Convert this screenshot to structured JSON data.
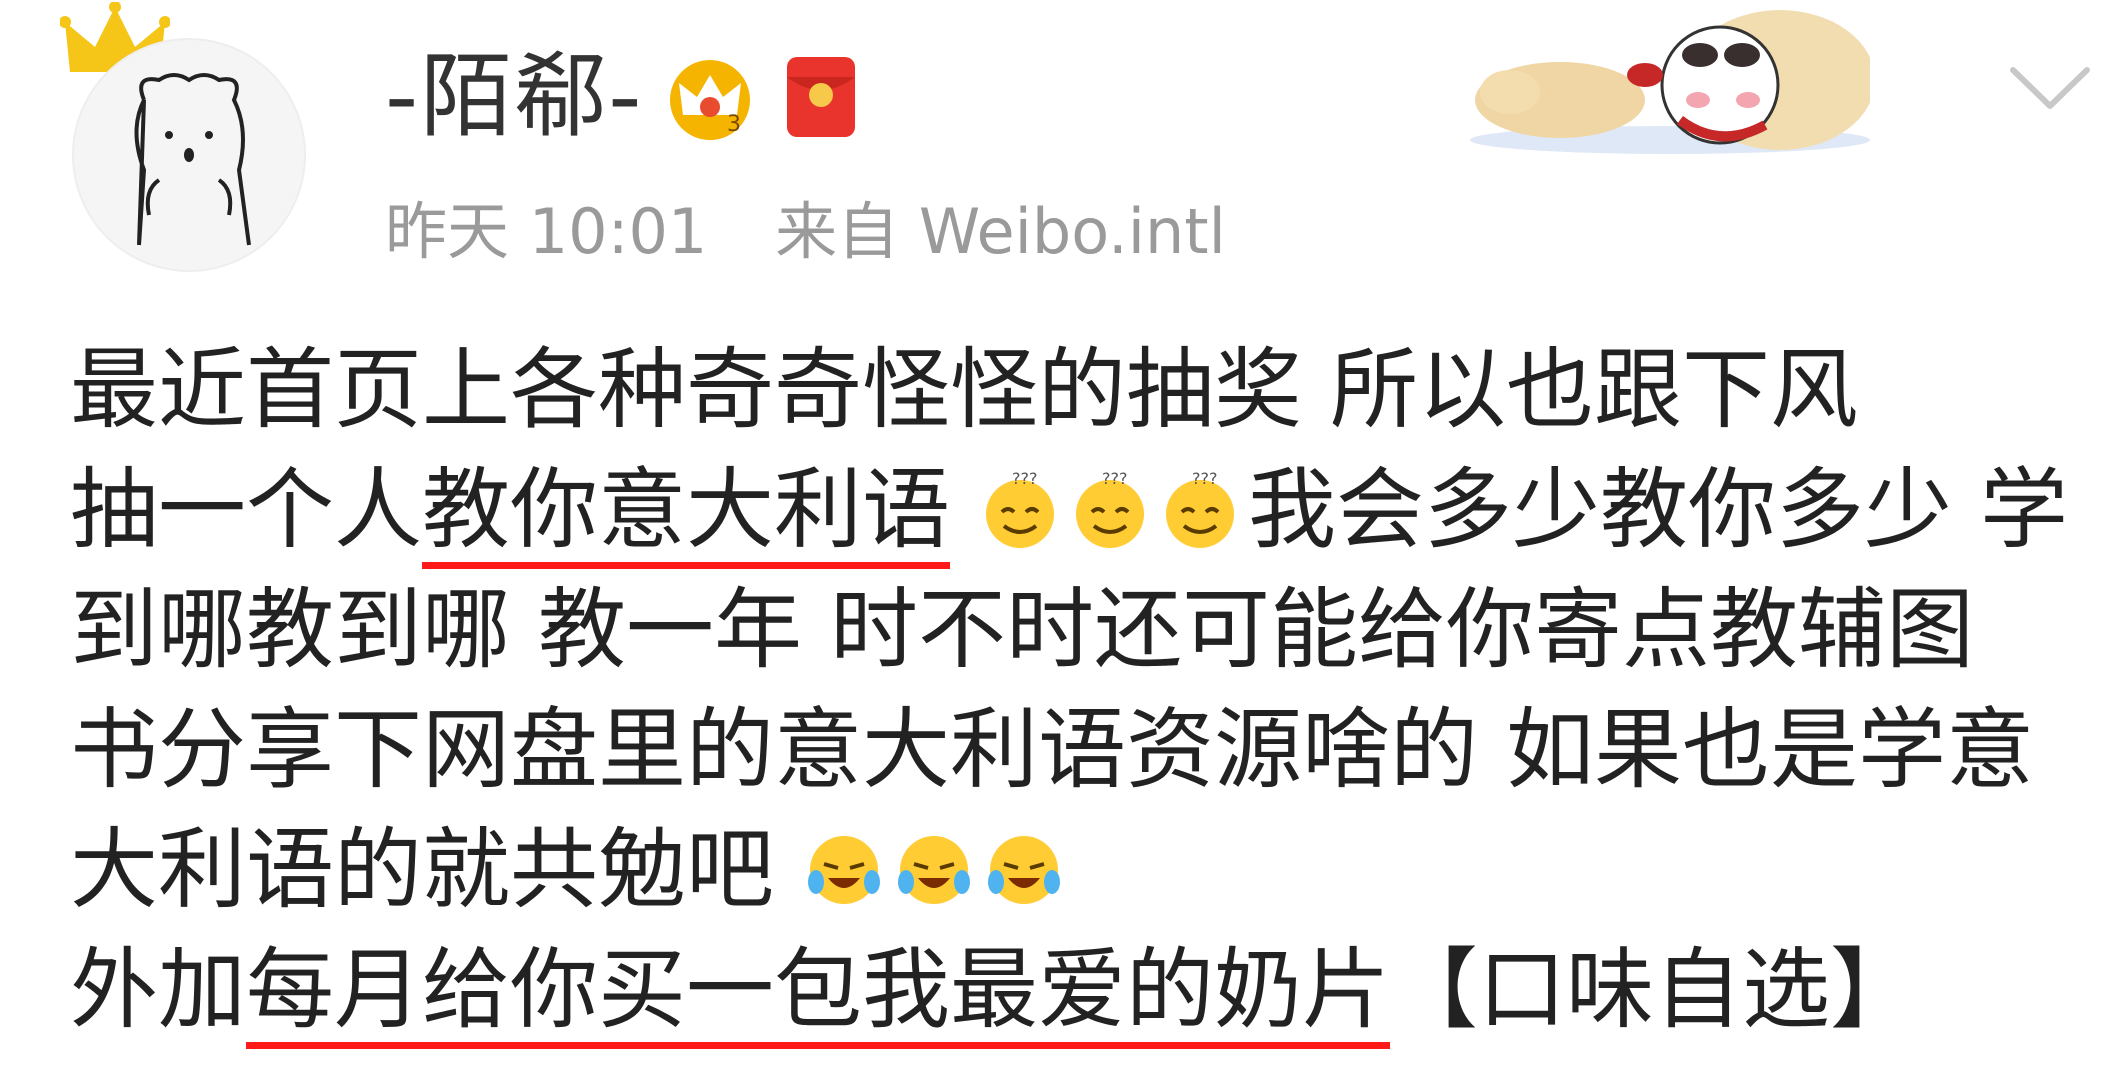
{
  "post": {
    "username": "-陌郗-",
    "time": "昨天 10:01",
    "source": "来自 Weibo.intl"
  },
  "content": {
    "l1": "最近首页上各种奇奇怪怪的抽奖 所以也跟下风",
    "l2a": "抽一个人",
    "l2b": "教你意大利语",
    "l2c": "我会多少教你多少 学",
    "l3": "到哪教到哪 教一年 时不时还可能给你寄点教辅图",
    "l4": "书分享下网盘里的意大利语资源啥的 如果也是学意",
    "l5": "大利语的就共勉吧",
    "l6a": "外加",
    "l6b": "每月给你买一包我最爱的奶片",
    "l6c": "【口味自选】"
  },
  "icons": {
    "avatar": "cartoon-bear-avatar",
    "crown": "crown-icon",
    "vip": "vip-crown-badge-icon",
    "redpacket": "red-envelope-icon",
    "emoji1": "dizzy-smile-emoji",
    "emoji2": "laugh-cry-emoji",
    "chevron": "chevron-down-icon"
  },
  "colors": {
    "underline": "#ff1a1a",
    "meta": "#9a9a9a",
    "text": "#222222",
    "vip": "#f5b400",
    "redpacket": "#e8342c"
  }
}
